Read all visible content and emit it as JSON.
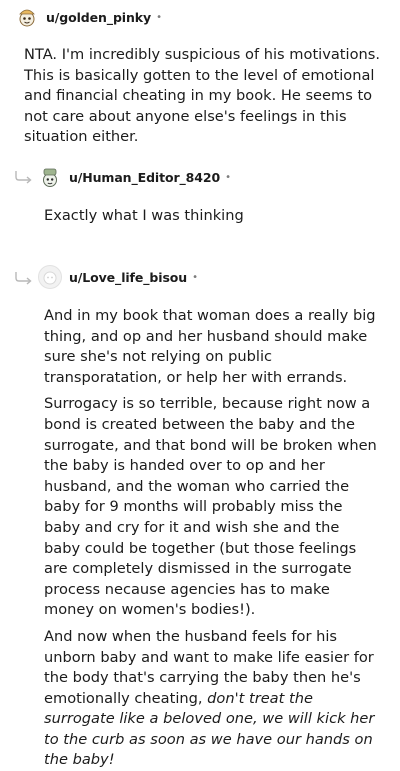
{
  "comments": [
    {
      "username": "u/golden_pinky",
      "dot": "•",
      "avatar_icon": "snoo-avatar-icon",
      "paragraphs": [
        "NTA. I'm incredibly suspicious of his motivations. This is basically gotten to the level of emotional and financial cheating in my book. He seems to not care about anyone else's feelings in this situation either."
      ]
    },
    {
      "username": "u/Human_Editor_8420",
      "dot": "•",
      "avatar_icon": "snoo-avatar-icon",
      "reply_icon": "reply-arrow-icon",
      "paragraphs": [
        "Exactly what I was thinking"
      ]
    },
    {
      "username": "u/Love_life_bisou",
      "dot": "•",
      "avatar_icon": "default-avatar-icon",
      "reply_icon": "reply-arrow-icon",
      "paragraphs": [
        "And in my book that woman does a really big thing, and op and her husband should make sure she's not relying on public transporatation, or help her with errands.",
        "Surrogacy is so terrible, because right now a bond is created between the baby and the surrogate, and that bond will be broken when the baby is handed over to op and her husband, and the woman who carried the baby for 9 months will probably miss the baby and cry for it and wish she and the baby could be together (but those feelings are completely dismissed in the surrogate process necause agencies has to make money on women's bodies!)."
      ],
      "last_paragraph_plain": "And now when the husband feels for his unborn baby and want to make life easier for the body that's carrying the baby then he's emotionally cheating, ",
      "last_paragraph_italic": "don't treat the surrogate like a beloved one, we will kick her to the curb as soon as we have our hands on the baby!"
    }
  ]
}
